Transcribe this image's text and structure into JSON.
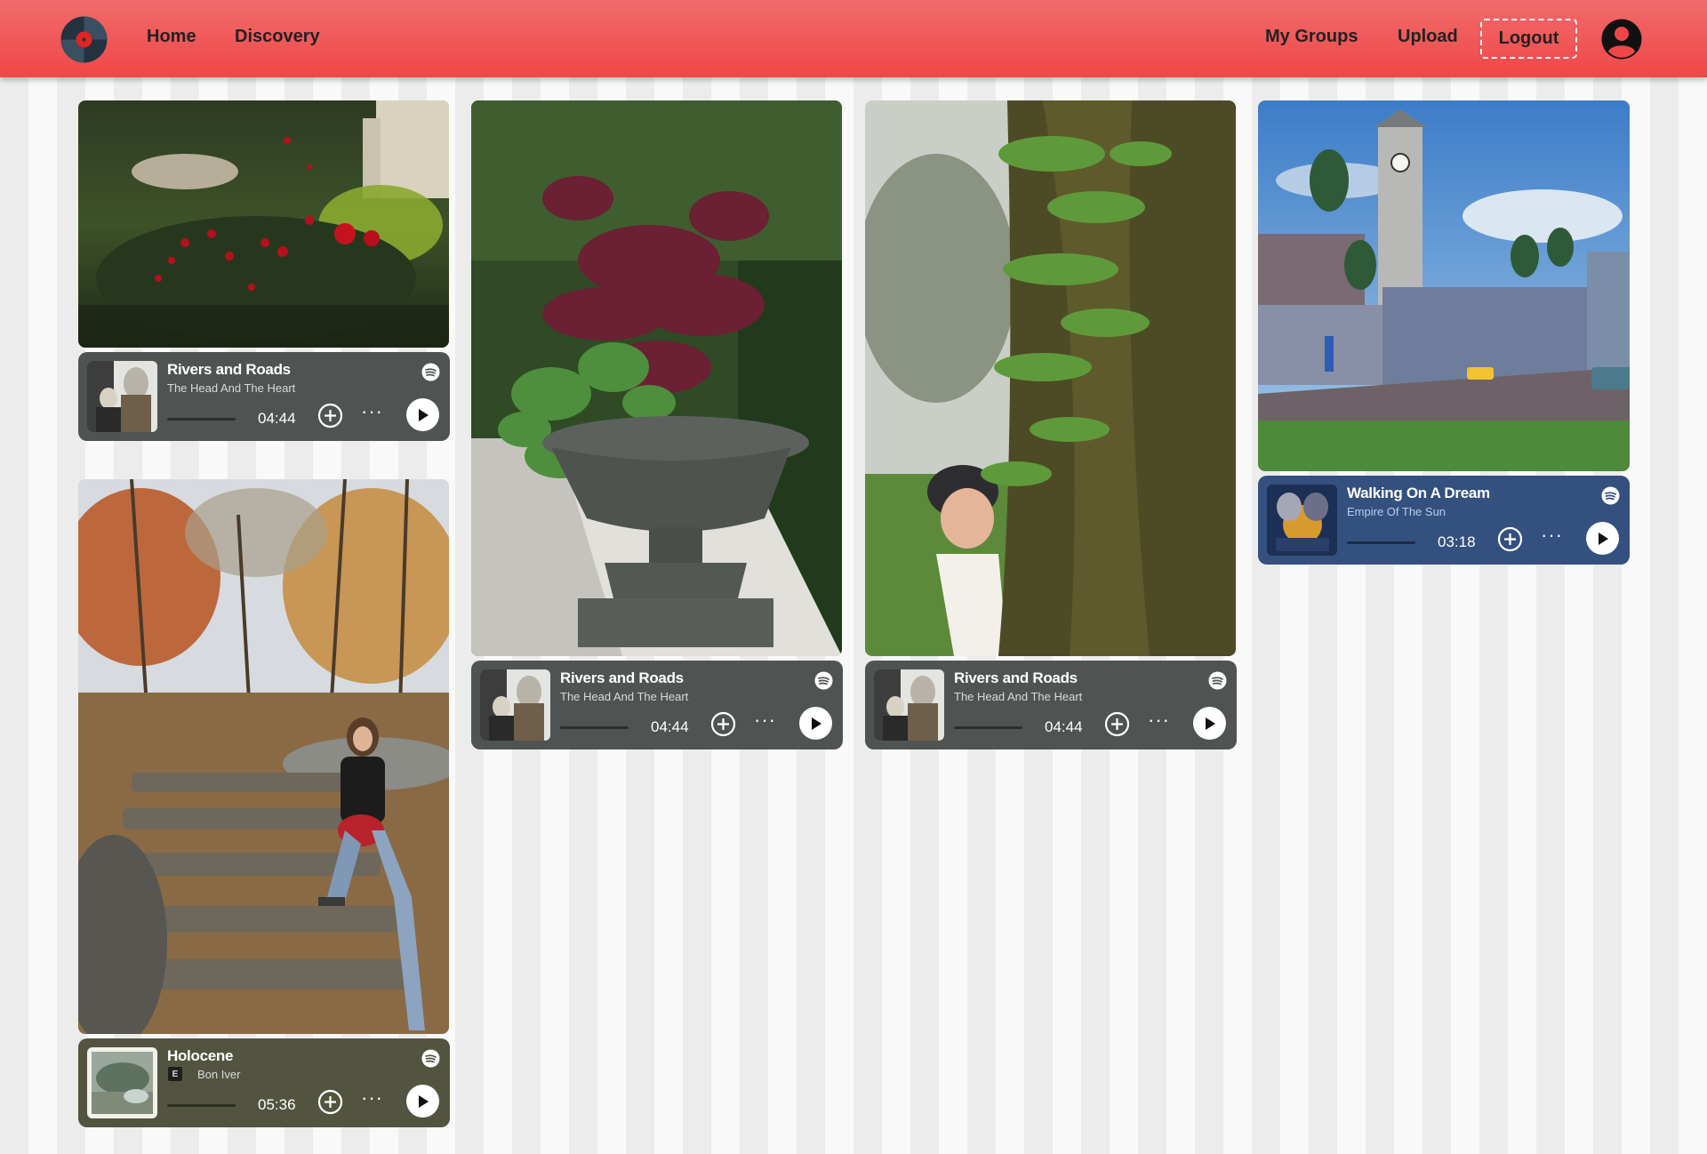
{
  "nav": {
    "home": "Home",
    "discovery": "Discovery",
    "my_groups": "My Groups",
    "upload": "Upload",
    "logout": "Logout"
  },
  "colors": {
    "nav_red": "#ef4747",
    "player_grey": "#4f5453",
    "player_olive": "#53543f",
    "player_blue": "#33507f"
  },
  "posts": [
    {
      "photo": "red-roses-garden",
      "song": {
        "title": "Rivers and Roads",
        "artist": "The Head And The Heart",
        "duration": "04:44",
        "explicit": false
      }
    },
    {
      "photo": "hiker-on-stone-steps",
      "song": {
        "title": "Holocene",
        "artist": "Bon Iver",
        "duration": "05:36",
        "explicit": true,
        "explicit_label": "E"
      }
    },
    {
      "photo": "plant-in-iron-urn",
      "song": {
        "title": "Rivers and Roads",
        "artist": "The Head And The Heart",
        "duration": "04:44",
        "explicit": false
      }
    },
    {
      "photo": "woman-behind-mossy-tree",
      "song": {
        "title": "Rivers and Roads",
        "artist": "The Head And The Heart",
        "duration": "04:44",
        "explicit": false
      }
    },
    {
      "photo": "game-town-clock-tower",
      "song": {
        "title": "Walking On A Dream",
        "artist": "Empire Of The Sun",
        "duration": "03:18",
        "explicit": false
      }
    }
  ],
  "icons": {
    "logo": "vinyl-record-icon",
    "avatar": "user-avatar-icon",
    "add": "plus-circle-icon",
    "more": "ellipsis-icon",
    "play": "play-icon",
    "brand": "spotify-icon"
  }
}
